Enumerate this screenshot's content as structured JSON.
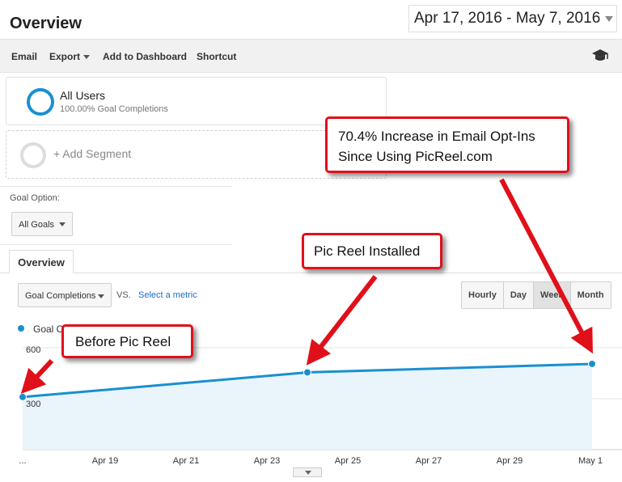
{
  "page": {
    "title": "Overview"
  },
  "date_range": {
    "value": "Apr 17, 2016 - May 7, 2016"
  },
  "toolbar": {
    "email_label": "Email",
    "export_label": "Export",
    "add_to_dashboard_label": "Add to Dashboard",
    "shortcut_label": "Shortcut"
  },
  "segments": {
    "all_users": {
      "name": "All Users",
      "sub": "100.00% Goal Completions"
    },
    "add_segment": "+ Add Segment"
  },
  "goal_option": {
    "label": "Goal Option:",
    "value": "All Goals"
  },
  "tabs": {
    "overview": "Overview"
  },
  "metric": {
    "selected": "Goal Completions",
    "vs": "VS.",
    "select_metric": "Select a metric"
  },
  "period_buttons": [
    "Hourly",
    "Day",
    "Week",
    "Month"
  ],
  "legend": {
    "series_label": "Goal C"
  },
  "chart_data": {
    "type": "line",
    "series": [
      {
        "name": "Goal Completions",
        "x": [
          "Apr 17",
          "Apr 24",
          "May 1"
        ],
        "values": [
          310,
          455,
          505
        ]
      }
    ],
    "x_ticks": [
      "...",
      "Apr 19",
      "Apr 21",
      "Apr 23",
      "Apr 25",
      "Apr 27",
      "Apr 29",
      "May 1"
    ],
    "y_ticks": [
      "600",
      "300"
    ],
    "ylim": [
      0,
      600
    ],
    "grid": true
  },
  "callouts": {
    "increase_line1": "70.4% Increase in Email Opt-Ins",
    "increase_line2": "Since Using PicReel.com",
    "installed": "Pic Reel Installed",
    "before": "Before Pic Reel"
  },
  "colors": {
    "accent": "#1a8fd0",
    "callout_border": "#e0101a",
    "area_fill": "#eaf4fb"
  }
}
